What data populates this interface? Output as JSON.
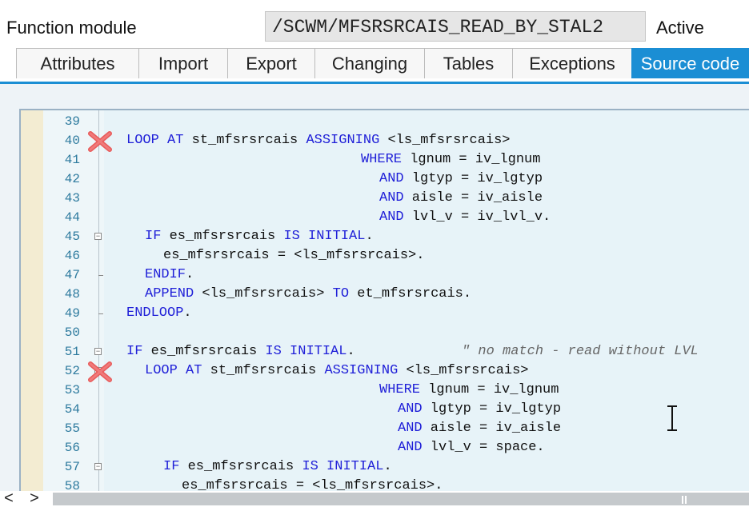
{
  "header": {
    "label": "Function module",
    "name": "/SCWM/MFSRSRCAIS_READ_BY_STAL2",
    "status": "Active"
  },
  "tabs": [
    {
      "label": "Attributes"
    },
    {
      "label": "Import"
    },
    {
      "label": "Export"
    },
    {
      "label": "Changing"
    },
    {
      "label": "Tables"
    },
    {
      "label": "Exceptions"
    },
    {
      "label": "Source code"
    }
  ],
  "editor": {
    "lines": [
      {
        "num": "39"
      },
      {
        "num": "40"
      },
      {
        "num": "41"
      },
      {
        "num": "42"
      },
      {
        "num": "43"
      },
      {
        "num": "44"
      },
      {
        "num": "45"
      },
      {
        "num": "46"
      },
      {
        "num": "47"
      },
      {
        "num": "48"
      },
      {
        "num": "49"
      },
      {
        "num": "50"
      },
      {
        "num": "51"
      },
      {
        "num": "52"
      },
      {
        "num": "53"
      },
      {
        "num": "54"
      },
      {
        "num": "55"
      },
      {
        "num": "56"
      },
      {
        "num": "57"
      },
      {
        "num": "58"
      }
    ],
    "code": {
      "l40": {
        "kw1": "LOOP AT",
        "t1": " st_mfsrsrcais ",
        "kw2": "ASSIGNING",
        "t2": " <ls_mfsrsrcais>"
      },
      "l41": {
        "kw1": "WHERE",
        "t1": " lgnum = iv_lgnum"
      },
      "l42": {
        "kw1": "AND",
        "t1": " lgtyp = iv_lgtyp"
      },
      "l43": {
        "kw1": "AND",
        "t1": " aisle = iv_aisle"
      },
      "l44": {
        "kw1": "AND",
        "t1": " lvl_v = iv_lvl_v."
      },
      "l45": {
        "kw1": "IF",
        "t1": " es_mfsrsrcais ",
        "kw2": "IS INITIAL",
        "t2": "."
      },
      "l46": {
        "t1": "es_mfsrsrcais = <ls_mfsrsrcais>."
      },
      "l47": {
        "kw1": "ENDIF",
        "t1": "."
      },
      "l48": {
        "kw1": "APPEND",
        "t1": " <ls_mfsrsrcais> ",
        "kw2": "TO",
        "t2": " et_mfsrsrcais."
      },
      "l49": {
        "kw1": "ENDLOOP",
        "t1": "."
      },
      "l51": {
        "kw1": "IF",
        "t1": " es_mfsrsrcais ",
        "kw2": "IS INITIAL",
        "t2": ".",
        "comment": "\" no match - read without LVL"
      },
      "l52": {
        "kw1": "LOOP AT",
        "t1": " st_mfsrsrcais ",
        "kw2": "ASSIGNING",
        "t2": " <ls_mfsrsrcais>"
      },
      "l53": {
        "kw1": "WHERE",
        "t1": " lgnum = iv_lgnum"
      },
      "l54": {
        "kw1": "AND",
        "t1": " lgtyp = iv_lgtyp"
      },
      "l55": {
        "kw1": "AND",
        "t1": " aisle = iv_aisle"
      },
      "l56": {
        "kw1": "AND",
        "t1": " lvl_v = space."
      },
      "l57": {
        "kw1": "IF",
        "t1": " es_mfsrsrcais ",
        "kw2": "IS INITIAL",
        "t2": "."
      },
      "l58": {
        "t1": "es_mfsrsrcais = <ls_mfsrsrcais>."
      }
    }
  },
  "scrollbar": {
    "left_glyph": "<",
    "right_glyph": ">"
  },
  "colors": {
    "accent": "#1b8ed4",
    "keyword": "#2020d8",
    "line_number": "#2d7a9e",
    "breakpoint": "#e85a5a"
  },
  "icons": {
    "breakpoint": "breakpoint-x-icon",
    "cursor": "text-cursor-icon",
    "fold": "fold-toggle-icon"
  }
}
